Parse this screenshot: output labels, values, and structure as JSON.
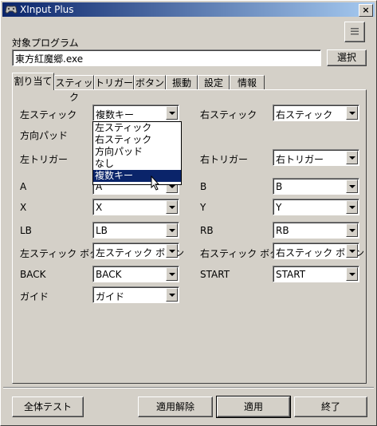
{
  "window": {
    "title": "XInput Plus",
    "close_label": "×"
  },
  "program": {
    "label": "対象プログラム",
    "value": "東方紅魔郷.exe",
    "select_button": "選択"
  },
  "tabs": [
    "割り当て",
    "スティック",
    "トリガー",
    "ボタン",
    "振動",
    "設定",
    "情報"
  ],
  "active_tab": "割り当て",
  "mapping": {
    "left_stick": {
      "label": "左スティック",
      "value": "複数キー"
    },
    "right_stick": {
      "label": "右スティック",
      "value": "右スティック"
    },
    "dpad": {
      "label": "方向パッド"
    },
    "left_trigger": {
      "label": "左トリガー"
    },
    "right_trigger": {
      "label": "右トリガー",
      "value": "右トリガー"
    },
    "a": {
      "label": "A",
      "value": "A"
    },
    "b": {
      "label": "B",
      "value": "B"
    },
    "x": {
      "label": "X",
      "value": "X"
    },
    "y": {
      "label": "Y",
      "value": "Y"
    },
    "lb": {
      "label": "LB",
      "value": "LB"
    },
    "rb": {
      "label": "RB",
      "value": "RB"
    },
    "ls_button": {
      "label": "左スティック ボタン",
      "value": "左スティック ボタン"
    },
    "rs_button": {
      "label": "右スティック ボタン",
      "value": "右スティック ボタン"
    },
    "back": {
      "label": "BACK",
      "value": "BACK"
    },
    "start": {
      "label": "START",
      "value": "START"
    },
    "guide": {
      "label": "ガイド",
      "value": "ガイド"
    }
  },
  "dropdown": {
    "items": [
      "左スティック",
      "右スティック",
      "方向パッド",
      "なし",
      "複数キー"
    ],
    "selected": "複数キー"
  },
  "footer": {
    "test_all": "全体テスト",
    "unapply": "適用解除",
    "apply": "適用",
    "exit": "終了"
  },
  "icons": {
    "app": "gamepad-icon",
    "menu": "menu-icon"
  }
}
